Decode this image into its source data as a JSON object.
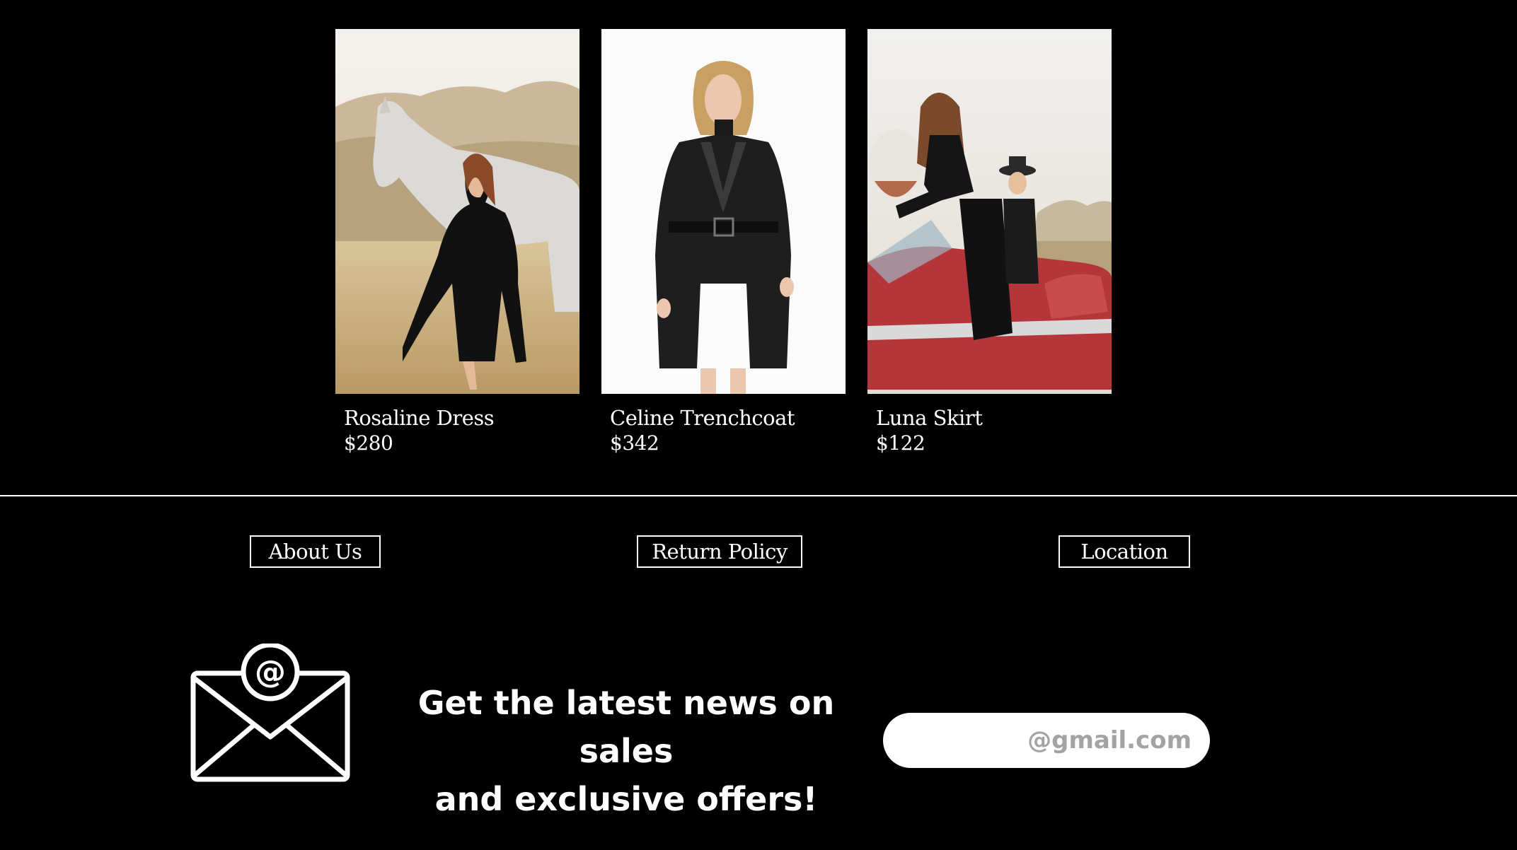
{
  "products": [
    {
      "name": "Rosaline Dress",
      "price": "$280",
      "image": "woman-with-white-horse-photo"
    },
    {
      "name": "Celine Trenchcoat",
      "price": "$342",
      "image": "woman-in-black-leather-trenchcoat-photo"
    },
    {
      "name": "Luna Skirt",
      "price": "$122",
      "image": "women-in-red-convertible-photo"
    }
  ],
  "footer": {
    "about_label": "About Us",
    "return_label": "Return Policy",
    "location_label": "Location"
  },
  "newsletter": {
    "icon": "mail-at-icon",
    "line1": "Get the latest news on sales",
    "line2": "and exclusive offers!",
    "email_placeholder": "@gmail.com"
  },
  "colors": {
    "background": "#000000",
    "foreground": "#ffffff",
    "placeholder": "#a3a3a3"
  }
}
